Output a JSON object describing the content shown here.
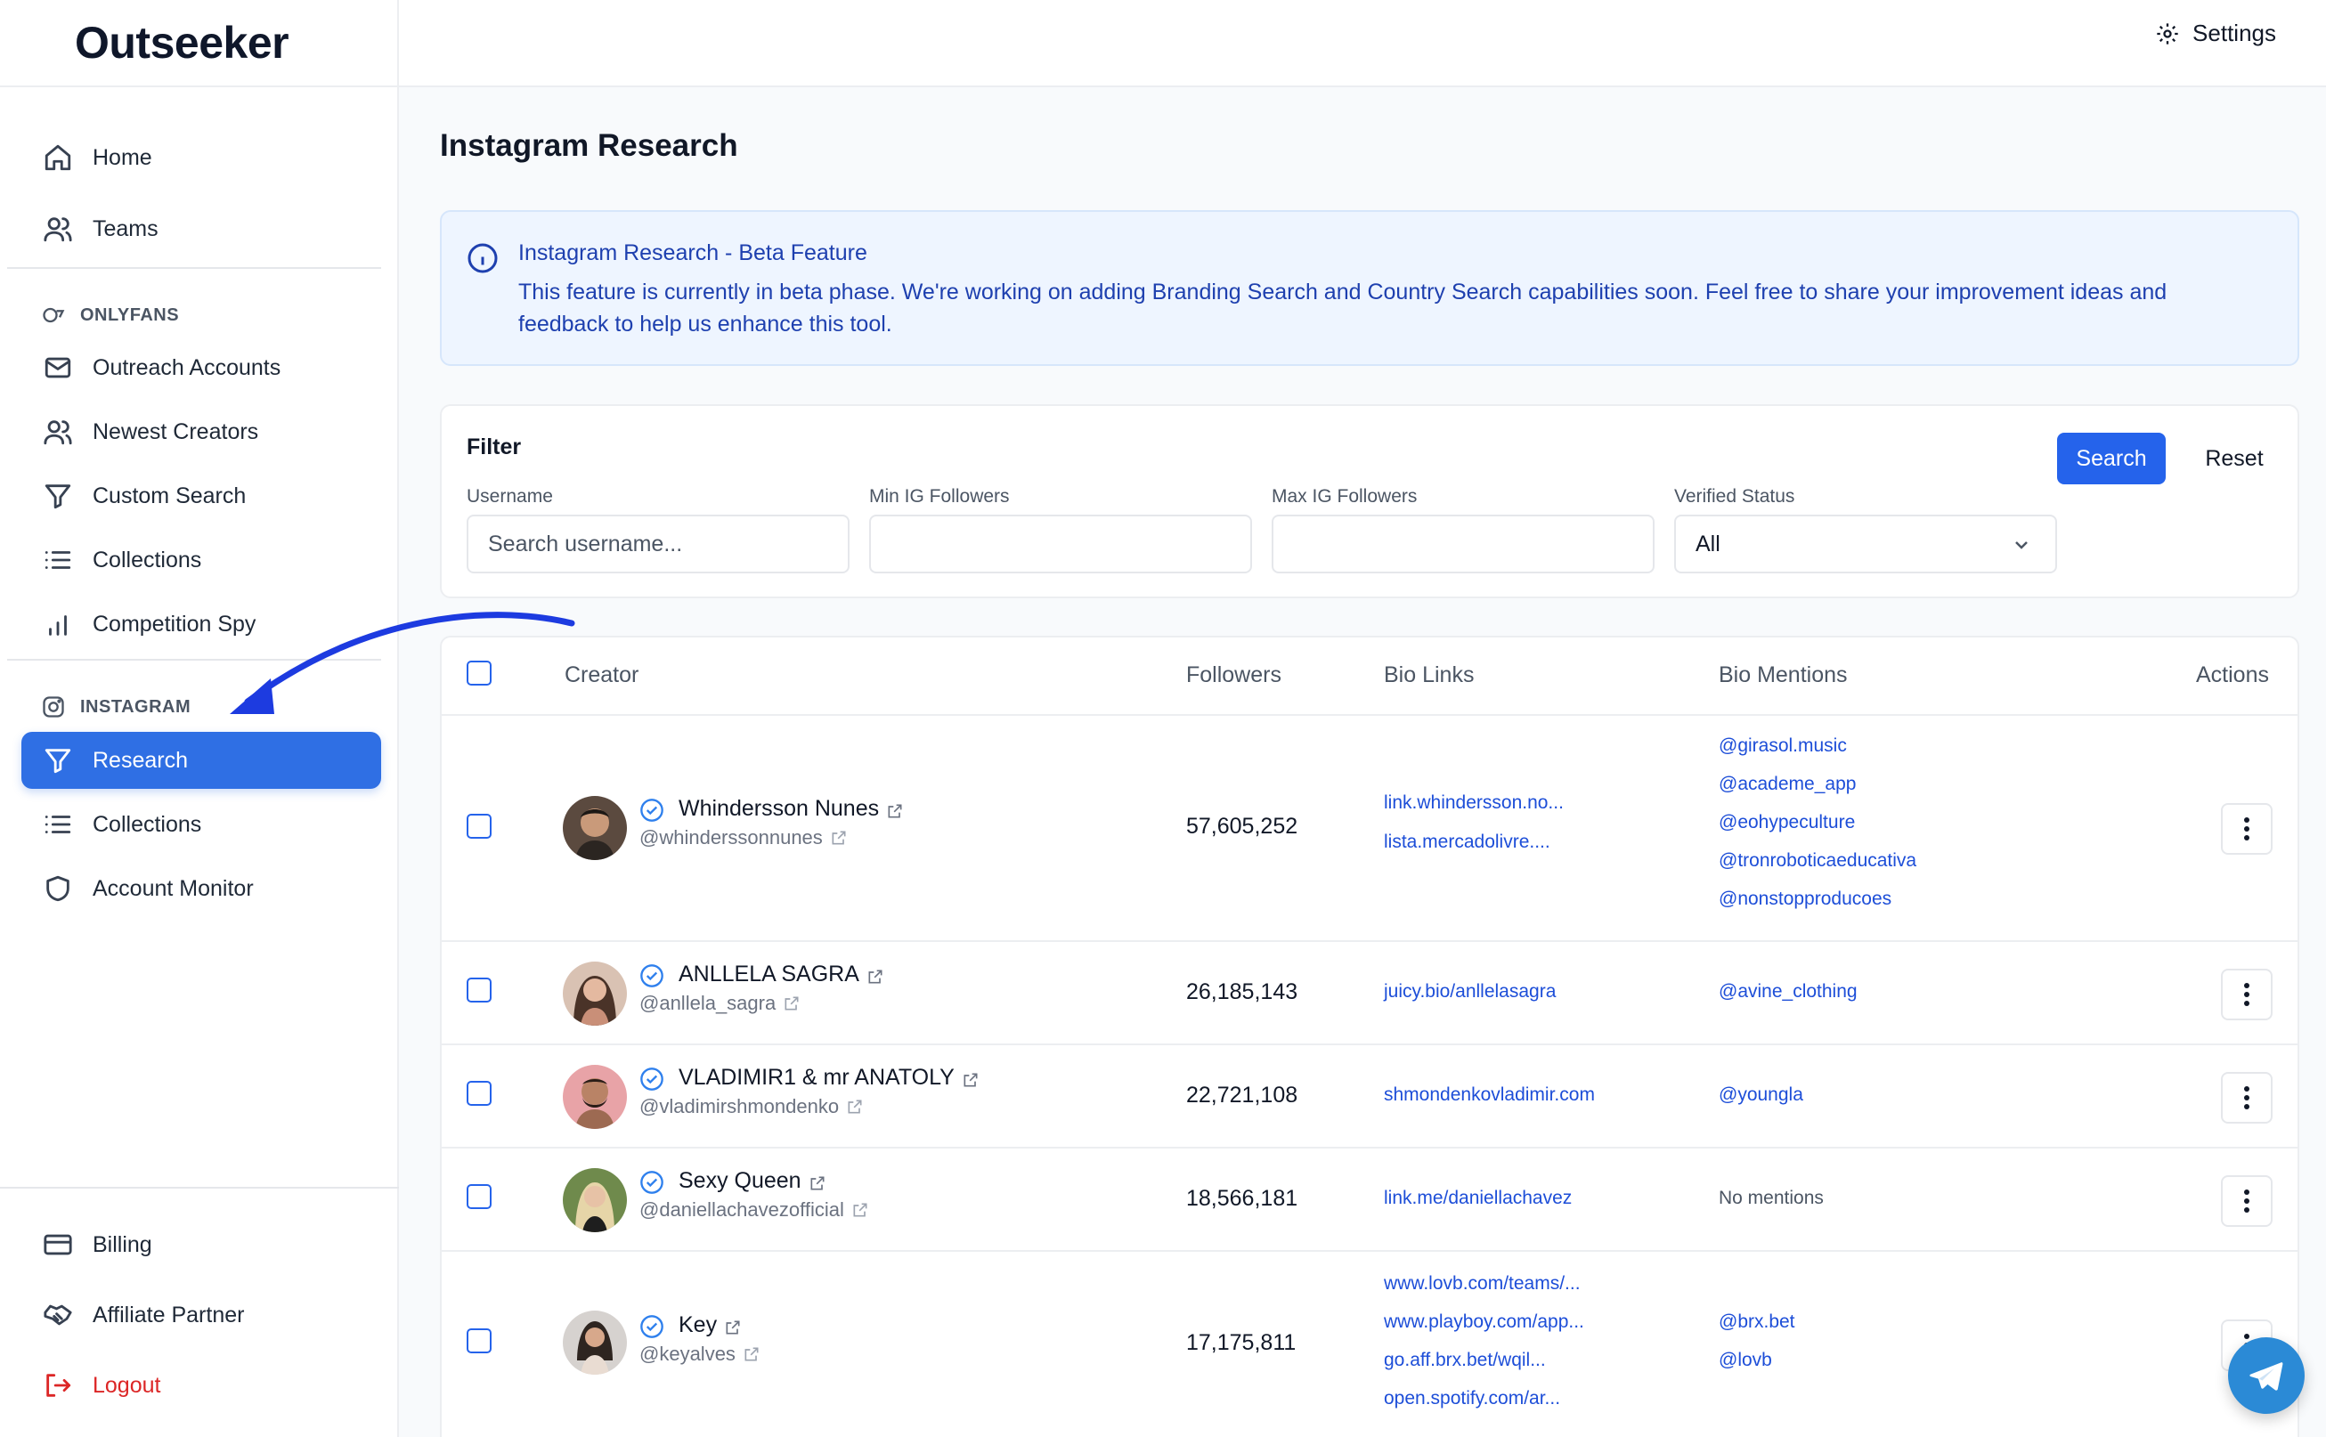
{
  "app": {
    "logo_text": "Outseeker"
  },
  "topbar": {
    "settings_label": "Settings"
  },
  "sidebar": {
    "home": "Home",
    "teams": "Teams",
    "onlyfans_section": "ONLYFANS",
    "outreach_accounts": "Outreach Accounts",
    "newest_creators": "Newest Creators",
    "custom_search": "Custom Search",
    "collections_of": "Collections",
    "competition_spy": "Competition Spy",
    "instagram_section": "INSTAGRAM",
    "research": "Research",
    "collections_ig": "Collections",
    "account_monitor": "Account Monitor",
    "billing": "Billing",
    "affiliate_partner": "Affiliate Partner",
    "logout": "Logout"
  },
  "page": {
    "title": "Instagram Research"
  },
  "banner": {
    "title": "Instagram Research - Beta Feature",
    "text": "This feature is currently in beta phase. We're working on adding Branding Search and Country Search capabilities soon. Feel free to share your improvement ideas and feedback to help us enhance this tool."
  },
  "filter": {
    "title": "Filter",
    "username_label": "Username",
    "username_placeholder": "Search username...",
    "min_label": "Min IG Followers",
    "max_label": "Max IG Followers",
    "verified_label": "Verified Status",
    "verified_value": "All",
    "search_btn": "Search",
    "reset_btn": "Reset"
  },
  "table": {
    "headers": {
      "creator": "Creator",
      "followers": "Followers",
      "bio_links": "Bio Links",
      "bio_mentions": "Bio Mentions",
      "actions": "Actions"
    },
    "rows": [
      {
        "name": "Whindersson Nunes",
        "handle": "@whinderssonnunes",
        "followers": "57,605,252",
        "links": [
          "link.whindersson.no...",
          "lista.mercadolivre...."
        ],
        "mentions": [
          "@girasol.music",
          "@academe_app",
          "@eohypeculture",
          "@tronroboticaeducativa",
          "@nonstopproducoes"
        ]
      },
      {
        "name": "ANLLELA SAGRA",
        "handle": "@anllela_sagra",
        "followers": "26,185,143",
        "links": [
          "juicy.bio/anllelasagra"
        ],
        "mentions": [
          "@avine_clothing"
        ]
      },
      {
        "name": "VLADIMIR1 & mr ANATOLY",
        "handle": "@vladimirshmondenko",
        "followers": "22,721,108",
        "links": [
          "shmondenkovladimir.com"
        ],
        "mentions": [
          "@youngla"
        ]
      },
      {
        "name": "Sexy Queen",
        "handle": "@daniellachavezofficial",
        "followers": "18,566,181",
        "links": [
          "link.me/daniellachavez"
        ],
        "no_mentions": "No mentions"
      },
      {
        "name": "Key",
        "handle": "@keyalves",
        "followers": "17,175,811",
        "links": [
          "www.lovb.com/teams/...",
          "www.playboy.com/app...",
          "go.aff.brx.bet/wqil...",
          "open.spotify.com/ar..."
        ],
        "mentions": [
          "@brx.bet",
          "@lovb"
        ]
      }
    ]
  },
  "colors": {
    "primary": "#2563eb",
    "active_nav": "#2f6fe4",
    "banner_bg": "#eef5ff",
    "banner_text": "#1e40af",
    "logout": "#dc2626",
    "annotation_arrow": "#1d3be0"
  },
  "icons": [
    "home-icon",
    "users-icon",
    "mail-icon",
    "filter-icon",
    "list-icon",
    "bar-chart-icon",
    "instagram-icon",
    "shield-icon",
    "credit-card-icon",
    "handshake-icon",
    "logout-icon",
    "gear-icon",
    "info-icon",
    "verified-icon",
    "external-link-icon",
    "more-vertical-icon",
    "telegram-icon",
    "chevron-down-icon"
  ]
}
